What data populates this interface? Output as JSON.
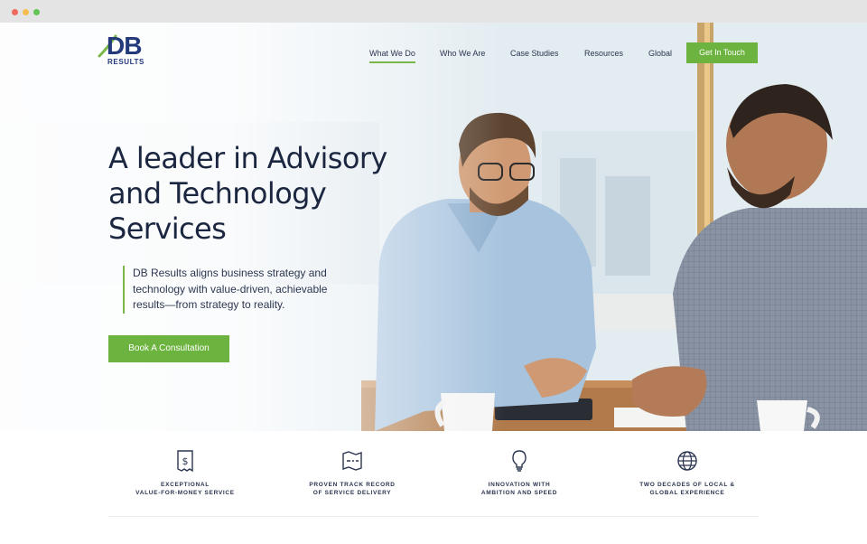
{
  "window": {
    "controls": [
      "close",
      "minimize",
      "maximize"
    ]
  },
  "header": {
    "logo": {
      "primary": "DB",
      "secondary": "RESULTS"
    },
    "nav": [
      {
        "label": "What We Do",
        "active": true
      },
      {
        "label": "Who We Are",
        "active": false
      },
      {
        "label": "Case Studies",
        "active": false
      },
      {
        "label": "Resources",
        "active": false
      },
      {
        "label": "Global",
        "active": false
      }
    ],
    "cta": "Get In Touch"
  },
  "hero": {
    "headline": "A leader in Advisory and Technology Services",
    "lead": "DB Results aligns business strategy and technology with value-driven, achievable results—from strategy to reality.",
    "cta": "Book A Consultation"
  },
  "features": [
    {
      "icon": "receipt-dollar-icon",
      "text": "EXCEPTIONAL\nVALUE-FOR-MONEY SERVICE"
    },
    {
      "icon": "map-route-icon",
      "text": "PROVEN TRACK RECORD\nOF SERVICE DELIVERY"
    },
    {
      "icon": "lightbulb-icon",
      "text": "INNOVATION WITH\nAMBITION AND SPEED"
    },
    {
      "icon": "globe-icon",
      "text": "TWO DECADES OF LOCAL &\nGLOBAL EXPERIENCE"
    }
  ],
  "colors": {
    "accent": "#6db33f",
    "brand": "#223a7a",
    "text": "#1b2640"
  }
}
